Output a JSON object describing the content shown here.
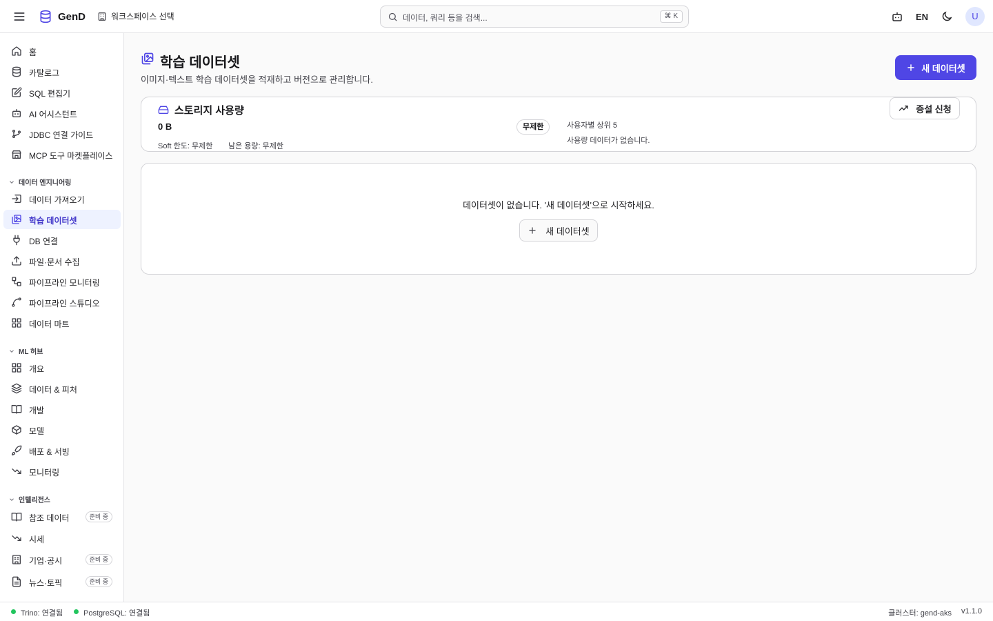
{
  "topbar": {
    "app_name": "GenD",
    "workspace_label": "워크스페이스 선택",
    "search_placeholder": "데이터, 쿼리 등을 검색...",
    "search_shortcut": "⌘ K",
    "language": "EN",
    "avatar_initial": "U"
  },
  "sidebar": {
    "main": [
      {
        "label": "홈",
        "icon": "home-icon"
      },
      {
        "label": "카탈로그",
        "icon": "database-icon"
      },
      {
        "label": "SQL 편집기",
        "icon": "edit-icon"
      },
      {
        "label": "AI 어시스턴트",
        "icon": "bot-icon"
      },
      {
        "label": "JDBC 연결 가이드",
        "icon": "git-icon"
      },
      {
        "label": "MCP 도구 마켓플레이스",
        "icon": "store-icon"
      }
    ],
    "sections": [
      {
        "title": "데이터 엔지니어링",
        "items": [
          {
            "label": "데이터 가져오기",
            "icon": "import-icon"
          },
          {
            "label": "학습 데이터셋",
            "icon": "images-icon",
            "active": true
          },
          {
            "label": "DB 연결",
            "icon": "plug-icon"
          },
          {
            "label": "파일·문서 수집",
            "icon": "upload-icon"
          },
          {
            "label": "파이프라인 모니터링",
            "icon": "workflow-icon"
          },
          {
            "label": "파이프라인 스튜디오",
            "icon": "spline-icon"
          },
          {
            "label": "데이터 마트",
            "icon": "grid-icon"
          }
        ]
      },
      {
        "title": "ML 허브",
        "items": [
          {
            "label": "개요",
            "icon": "grid-icon"
          },
          {
            "label": "데이터 & 피처",
            "icon": "layers-icon"
          },
          {
            "label": "개발",
            "icon": "book-icon"
          },
          {
            "label": "모델",
            "icon": "box-icon"
          },
          {
            "label": "배포 & 서빙",
            "icon": "rocket-icon"
          },
          {
            "label": "모니터링",
            "icon": "trend-down-icon"
          }
        ]
      },
      {
        "title": "인텔리전스",
        "items": [
          {
            "label": "참조 데이터",
            "icon": "book-icon",
            "badge": "준비 중"
          },
          {
            "label": "시세",
            "icon": "trend-down-icon"
          },
          {
            "label": "기업·공시",
            "icon": "building-icon",
            "badge": "준비 중"
          },
          {
            "label": "뉴스·토픽",
            "icon": "file-icon",
            "badge": "준비 중"
          }
        ]
      }
    ]
  },
  "page": {
    "title": "학습 데이터셋",
    "description": "이미지·텍스트 학습 데이터셋을 적재하고 버전으로 관리합니다.",
    "new_button": "새 데이터셋"
  },
  "storage": {
    "title": "스토리지 사용량",
    "used": "0 B",
    "soft_limit": "Soft 한도: 무제한",
    "remaining": "남은 용량: 무제한",
    "badge": "무제한",
    "top_users_title": "사용자별 상위 5",
    "top_users_empty": "사용량 데이터가 없습니다.",
    "increase_button": "증설 신청"
  },
  "empty_state": {
    "message": "데이터셋이 없습니다. '새 데이터셋'으로 시작하세요.",
    "button": "새 데이터셋"
  },
  "statusbar": {
    "trino": "Trino: 연결됨",
    "postgres": "PostgreSQL: 연결됨",
    "cluster": "클러스터: gend-aks",
    "version": "v1.1.0",
    "status_color": "#22c55e"
  },
  "colors": {
    "accent": "#4f46e5"
  }
}
